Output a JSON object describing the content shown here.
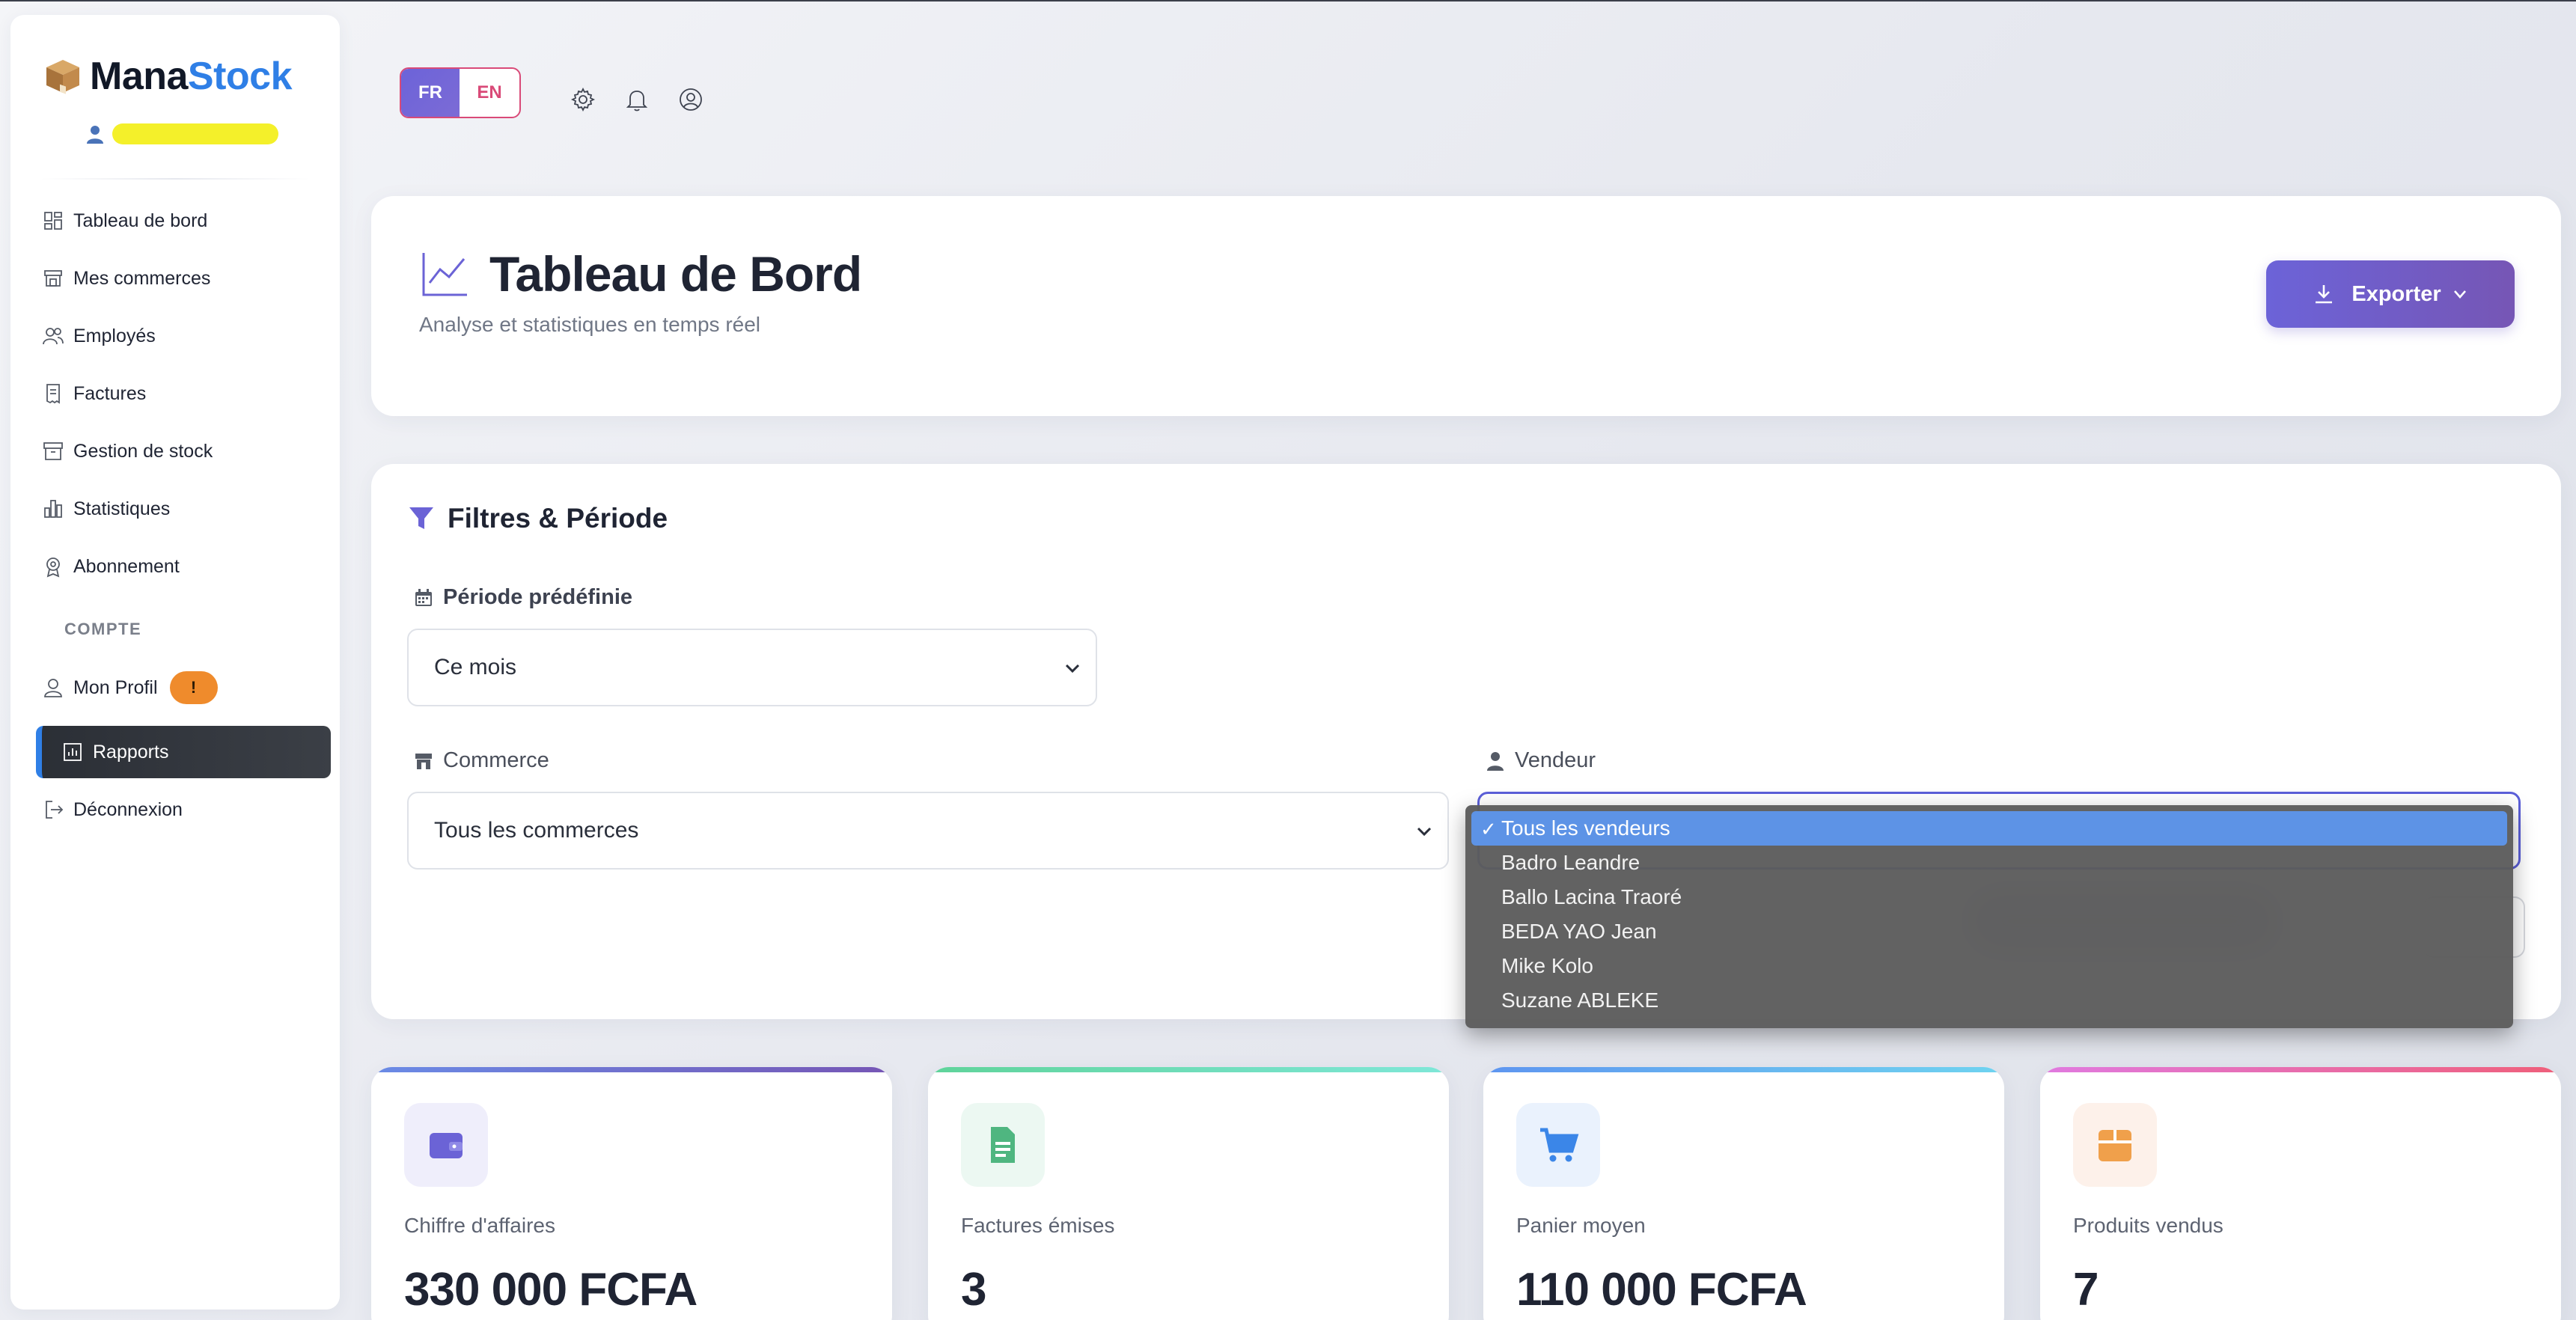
{
  "app": {
    "brand_part1": "Mana",
    "brand_part2": "Stock"
  },
  "colors": {
    "accent": "#6c63d8",
    "brand_blue": "#2f7fe6",
    "warning": "#ef8b2c",
    "selected": "#5d93e6"
  },
  "sidebar": {
    "items": [
      {
        "label": "Tableau de bord",
        "icon": "dashboard-icon"
      },
      {
        "label": "Mes commerces",
        "icon": "store-icon"
      },
      {
        "label": "Employés",
        "icon": "users-icon"
      },
      {
        "label": "Factures",
        "icon": "invoice-icon"
      },
      {
        "label": "Gestion de stock",
        "icon": "archive-icon"
      },
      {
        "label": "Statistiques",
        "icon": "bar-chart-icon"
      },
      {
        "label": "Abonnement",
        "icon": "award-icon"
      }
    ],
    "section_account": "COMPTE",
    "profile": {
      "label": "Mon Profil",
      "badge": "!"
    },
    "active": {
      "label": "Rapports",
      "icon": "report-icon"
    },
    "logout": {
      "label": "Déconnexion",
      "icon": "logout-icon"
    }
  },
  "toolbar": {
    "lang_fr": "FR",
    "lang_en": "EN"
  },
  "header": {
    "title": "Tableau de Bord",
    "subtitle": "Analyse et statistiques en temps réel",
    "export_label": "Exporter"
  },
  "filters": {
    "title": "Filtres & Période",
    "period_label": "Période prédéfinie",
    "period_value": "Ce mois",
    "commerce_label": "Commerce",
    "commerce_value": "Tous les commerces",
    "seller_label": "Vendeur",
    "seller_options": [
      "Tous les vendeurs",
      "Badro Leandre",
      "Ballo Lacina Traoré",
      "BEDA YAO Jean",
      "Mike Kolo",
      "Suzane ABLEKE"
    ]
  },
  "stats": [
    {
      "label": "Chiffre d'affaires",
      "value": "330 000 FCFA",
      "icon": "wallet-icon"
    },
    {
      "label": "Factures émises",
      "value": "3",
      "icon": "document-icon"
    },
    {
      "label": "Panier moyen",
      "value": "110 000 FCFA",
      "icon": "cart-icon"
    },
    {
      "label": "Produits vendus",
      "value": "7",
      "icon": "box-icon"
    }
  ]
}
